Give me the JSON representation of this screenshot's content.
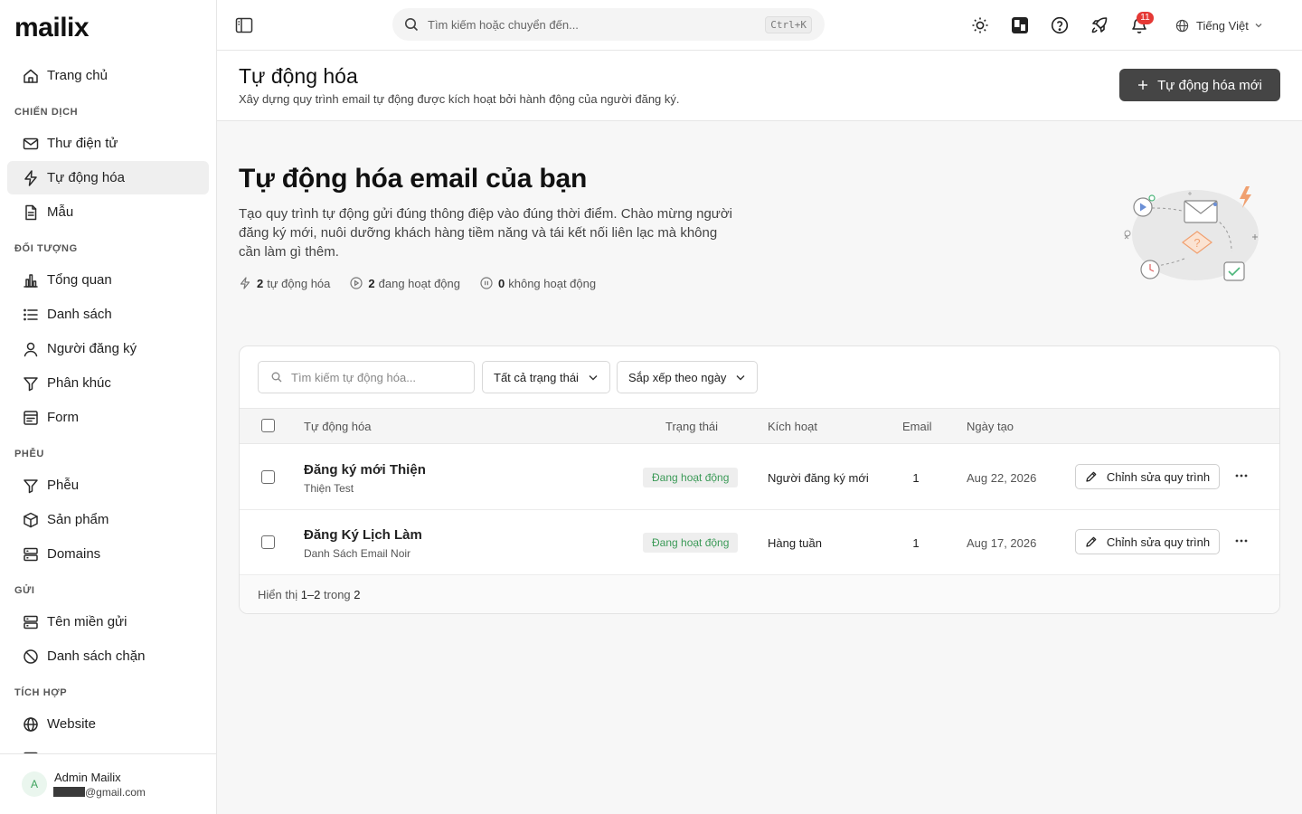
{
  "app": {
    "logo": "mailix"
  },
  "sidebar": {
    "items": [
      {
        "type": "item",
        "label": "Trang chủ",
        "icon": "home-icon"
      },
      {
        "type": "section",
        "label": "CHIẾN DỊCH"
      },
      {
        "type": "item",
        "label": "Thư điện tử",
        "icon": "mail-icon"
      },
      {
        "type": "item",
        "label": "Tự động hóa",
        "icon": "lightning-icon",
        "active": true
      },
      {
        "type": "item",
        "label": "Mẫu",
        "icon": "document-icon"
      },
      {
        "type": "section",
        "label": "ĐỐI TƯỢNG"
      },
      {
        "type": "item",
        "label": "Tổng quan",
        "icon": "bar-chart-icon"
      },
      {
        "type": "item",
        "label": "Danh sách",
        "icon": "list-icon"
      },
      {
        "type": "item",
        "label": "Người đăng ký",
        "icon": "user-icon"
      },
      {
        "type": "item",
        "label": "Phân khúc",
        "icon": "filter-icon"
      },
      {
        "type": "item",
        "label": "Form",
        "icon": "form-icon"
      },
      {
        "type": "section",
        "label": "PHỄU"
      },
      {
        "type": "item",
        "label": "Phễu",
        "icon": "funnel-icon"
      },
      {
        "type": "item",
        "label": "Sản phẩm",
        "icon": "box-icon"
      },
      {
        "type": "item",
        "label": "Domains",
        "icon": "server-icon"
      },
      {
        "type": "section",
        "label": "GỬI"
      },
      {
        "type": "item",
        "label": "Tên miền gửi",
        "icon": "server-icon"
      },
      {
        "type": "item",
        "label": "Danh sách chặn",
        "icon": "ban-icon"
      },
      {
        "type": "section",
        "label": "TÍCH HỢP"
      },
      {
        "type": "item",
        "label": "Website",
        "icon": "globe-icon"
      },
      {
        "type": "item",
        "label": "",
        "icon": "server-icon"
      }
    ],
    "user": {
      "avatar_letter": "A",
      "name": "Admin Mailix",
      "email_suffix": "@gmail.com"
    }
  },
  "topbar": {
    "search_placeholder": "Tìm kiếm hoặc chuyển đến...",
    "shortcut": "Ctrl+K",
    "notification_count": "11",
    "language": "Tiếng Việt"
  },
  "header": {
    "title": "Tự động hóa",
    "subtitle": "Xây dựng quy trình email tự động được kích hoạt bởi hành động của người đăng ký.",
    "new_button": "Tự động hóa mới"
  },
  "hero": {
    "title": "Tự động hóa email của bạn",
    "description": "Tạo quy trình tự động gửi đúng thông điệp vào đúng thời điểm. Chào mừng người đăng ký mới, nuôi dưỡng khách hàng tiềm năng và tái kết nối liên lạc mà không cần làm gì thêm.",
    "stats": {
      "total_count": "2",
      "total_label": "tự động hóa",
      "active_count": "2",
      "active_label": "đang hoạt động",
      "inactive_count": "0",
      "inactive_label": "không hoạt động"
    }
  },
  "filters": {
    "search_placeholder": "Tìm kiếm tự động hóa...",
    "status_select": "Tất cả trạng thái",
    "sort_select": "Sắp xếp theo ngày"
  },
  "table": {
    "columns": {
      "name": "Tự động hóa",
      "status": "Trạng thái",
      "trigger": "Kích hoạt",
      "email": "Email",
      "created": "Ngày tạo"
    },
    "rows": [
      {
        "name": "Đăng ký mới Thiện",
        "list": "Thiện Test",
        "status": "Đang hoạt động",
        "trigger": "Người đăng ký mới",
        "emails": "1",
        "created": "Aug 22, 2026",
        "edit_label": "Chỉnh sửa quy trình"
      },
      {
        "name": "Đăng Ký Lịch Làm",
        "list": "Danh Sách Email Noir",
        "status": "Đang hoạt động",
        "trigger": "Hàng tuần",
        "emails": "1",
        "created": "Aug 17, 2026",
        "edit_label": "Chỉnh sửa quy trình"
      }
    ],
    "pager": {
      "prefix": "Hiển thị",
      "range": "1–2",
      "middle": "trong",
      "total": "2"
    }
  },
  "colors": {
    "primary_button": "#454545",
    "active_green": "#3b9a57",
    "badge_red": "#e53935",
    "accent_orange": "#f0a070"
  }
}
